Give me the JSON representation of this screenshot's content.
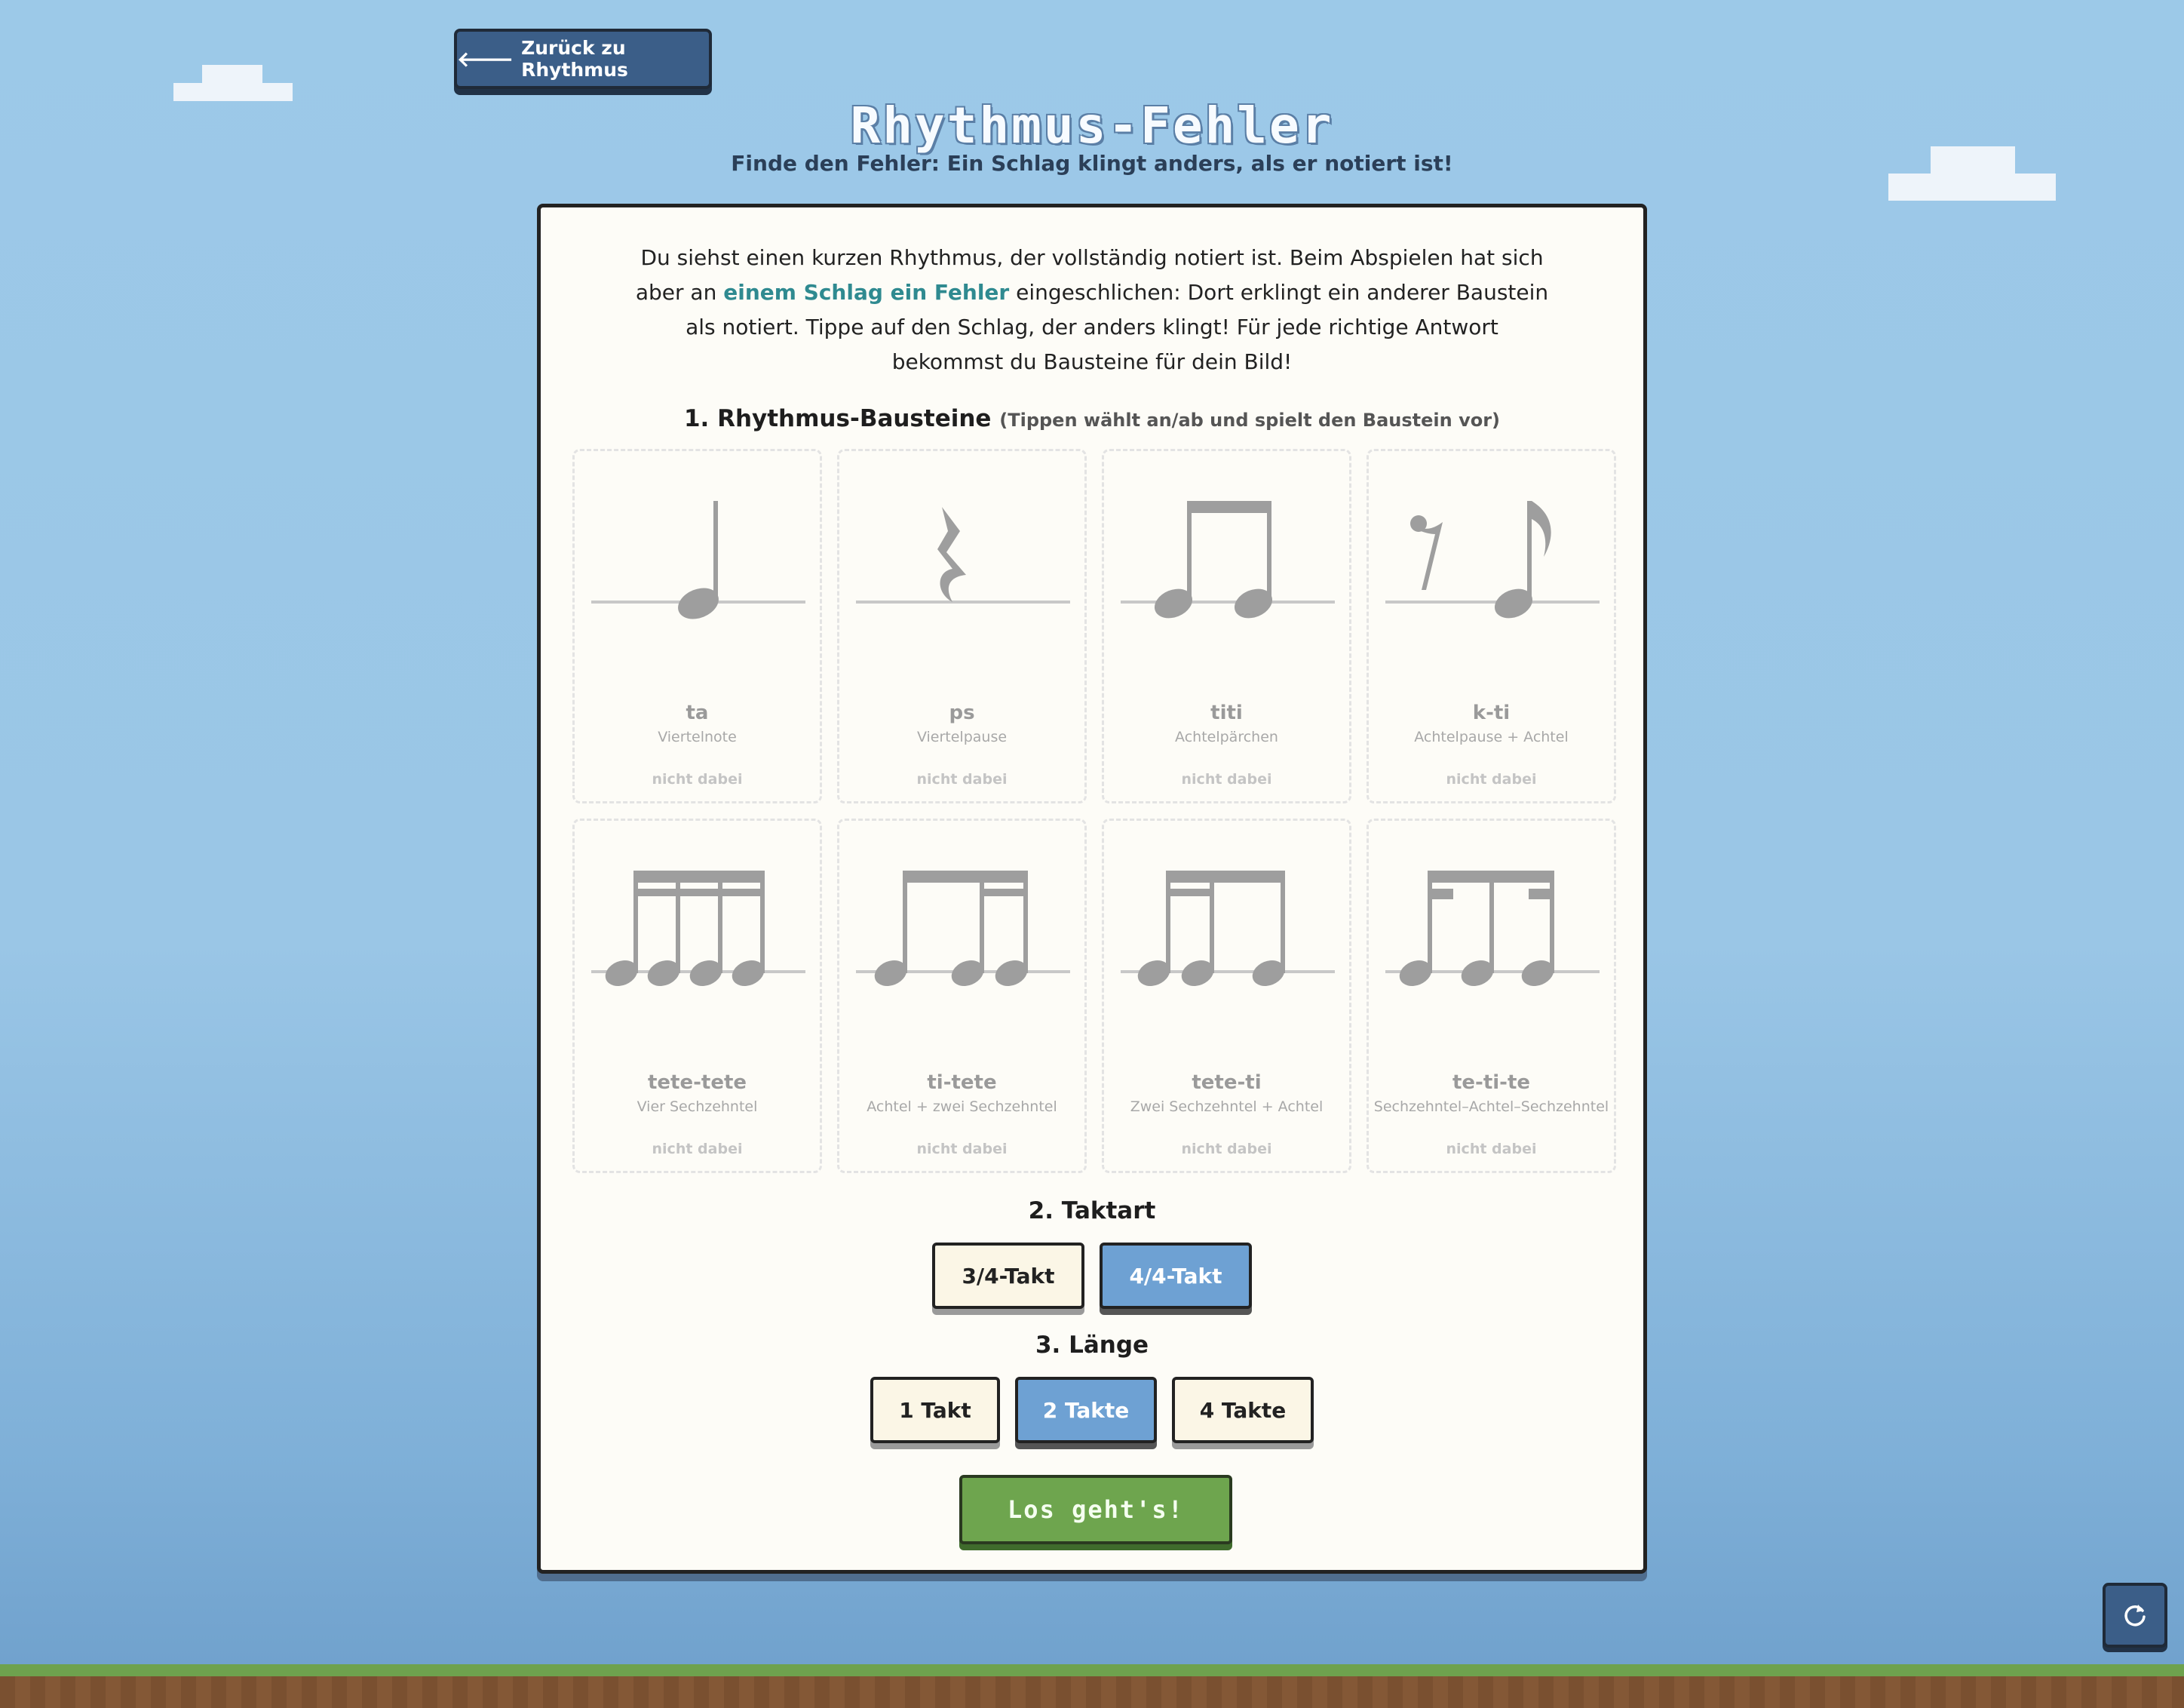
{
  "nav": {
    "back_label": "Zurück zu Rhythmus"
  },
  "header": {
    "title": "Rhythmus-Fehler",
    "subtitle": "Finde den Fehler: Ein Schlag klingt anders, als er notiert ist!"
  },
  "intro": {
    "part1": "Du siehst einen kurzen Rhythmus, der vollständig notiert ist. Beim Abspielen hat sich aber an ",
    "highlight": "einem Schlag ein Fehler",
    "part2": " eingeschlichen: Dort erklingt ein anderer Baustein als notiert. Tippe auf den Schlag, der anders klingt! Für jede richtige Antwort bekommst du Bausteine für dein Bild!"
  },
  "section1": {
    "title": "1. Rhythmus-Bausteine",
    "hint": "(Tippen wählt an/ab und spielt den Baustein vor)",
    "cards": [
      {
        "name": "ta",
        "desc": "Viertelnote",
        "status": "nicht dabei",
        "icon": "quarter-note-icon"
      },
      {
        "name": "ps",
        "desc": "Viertelpause",
        "status": "nicht dabei",
        "icon": "quarter-rest-icon"
      },
      {
        "name": "titi",
        "desc": "Achtelpärchen",
        "status": "nicht dabei",
        "icon": "eighth-pair-icon"
      },
      {
        "name": "k-ti",
        "desc": "Achtelpause + Achtel",
        "status": "nicht dabei",
        "icon": "eighth-rest-eighth-icon"
      },
      {
        "name": "tete-tete",
        "desc": "Vier Sechzehntel",
        "status": "nicht dabei",
        "icon": "four-sixteenths-icon"
      },
      {
        "name": "ti-tete",
        "desc": "Achtel + zwei Sechzehntel",
        "status": "nicht dabei",
        "icon": "eighth-two-sixteenths-icon"
      },
      {
        "name": "tete-ti",
        "desc": "Zwei Sechzehntel + Achtel",
        "status": "nicht dabei",
        "icon": "two-sixteenths-eighth-icon"
      },
      {
        "name": "te-ti-te",
        "desc": "Sechzehntel–Achtel–Sechzehntel",
        "status": "nicht dabei",
        "icon": "sixteenth-eighth-sixteenth-icon"
      }
    ]
  },
  "section2": {
    "title": "2. Taktart",
    "options": [
      {
        "label": "3/4-Takt",
        "selected": false
      },
      {
        "label": "4/4-Takt",
        "selected": true
      }
    ]
  },
  "section3": {
    "title": "3. Länge",
    "options": [
      {
        "label": "1 Takt",
        "selected": false
      },
      {
        "label": "2 Takte",
        "selected": true
      },
      {
        "label": "4 Takte",
        "selected": false
      }
    ]
  },
  "start_label": "Los geht's!",
  "colors": {
    "accent_blue": "#6ea1d3",
    "button_dark": "#3b5e88",
    "go_green": "#6ea54e",
    "highlight_teal": "#2f8a90"
  }
}
